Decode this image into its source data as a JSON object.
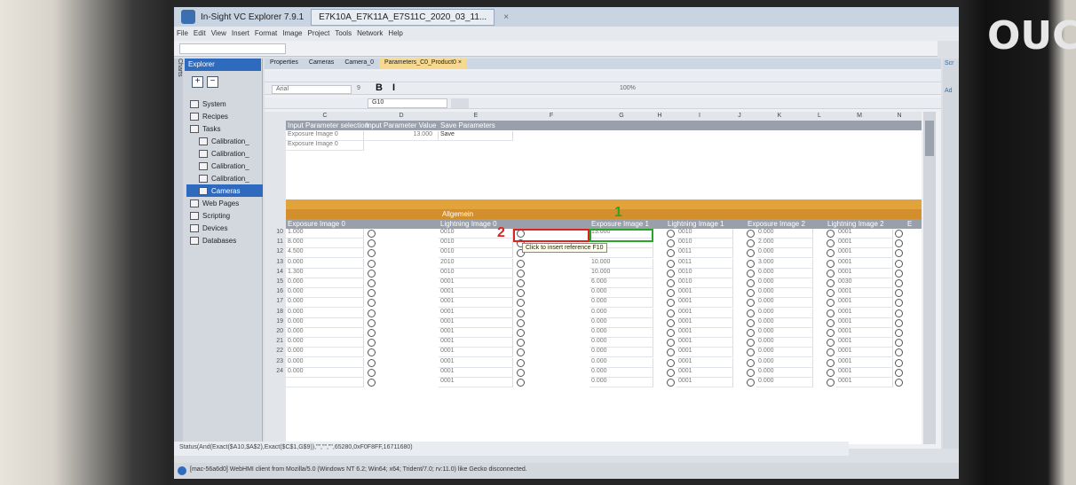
{
  "window": {
    "app_title": "In-Sight VC Explorer 7.9.1",
    "doc_tab": "E7K10A_E7K11A_E7S11C_2020_03_11...",
    "close_glyph": "×"
  },
  "brand_text": "OUCH",
  "menu": [
    "File",
    "Edit",
    "View",
    "Insert",
    "Format",
    "Image",
    "Project",
    "Tools",
    "Network",
    "Help"
  ],
  "sidebar": {
    "vertical_tab": "Charts",
    "header": "Explorer",
    "expand_glyph": "+",
    "collapse_glyph": "−",
    "items": [
      {
        "label": "System",
        "indent": 1
      },
      {
        "label": "Recipes",
        "indent": 1
      },
      {
        "label": "Tasks",
        "indent": 1
      },
      {
        "label": "Calibration_",
        "indent": 2
      },
      {
        "label": "Calibration_",
        "indent": 2
      },
      {
        "label": "Calibration_",
        "indent": 2
      },
      {
        "label": "Calibration_",
        "indent": 2
      },
      {
        "label": "Cameras",
        "indent": 2,
        "selected": true
      },
      {
        "label": "Web Pages",
        "indent": 1
      },
      {
        "label": "Scripting",
        "indent": 1
      },
      {
        "label": "Devices",
        "indent": 1
      },
      {
        "label": "Databases",
        "indent": 1
      }
    ]
  },
  "doc_tabs": [
    "Properties",
    "Cameras",
    "Camera_0",
    "Parameters_C0_Product0 ×"
  ],
  "toolbar": {
    "font": "Arial",
    "size": "9",
    "format_buttons": "B I",
    "cell_ref": "G10",
    "zoom": "100%"
  },
  "columns": [
    "C",
    "D",
    "E",
    "F",
    "G",
    "H",
    "I",
    "J",
    "K",
    "L",
    "M",
    "N"
  ],
  "top_headers": {
    "c": "Input Parameter selection",
    "d": "Input Parameter Value",
    "e": "Save Parameters"
  },
  "row1": {
    "c": "Exposure Image 0",
    "d": "13.000",
    "e": "Save"
  },
  "row2": {
    "c": "Exposure Image 0"
  },
  "section_label": "Allgemein",
  "lower_headers": {
    "c": "Exposure Image 0",
    "e": "Lightning Image 0",
    "g": "Exposure Image 1",
    "i": "Lightning Image 1",
    "k": "Exposure Image 2",
    "m": "Lightning Image 2",
    "n": "E"
  },
  "rows": [
    {
      "n": "10",
      "c": "1.000",
      "e": "0010",
      "g": "13.000",
      "i": "0010",
      "k": "0.000",
      "m": "0001"
    },
    {
      "n": "11",
      "c": "8.000",
      "e": "0010",
      "g": "",
      "i": "0010",
      "k": "2.000",
      "m": "0001"
    },
    {
      "n": "12",
      "c": "4.500",
      "e": "0010",
      "g": "",
      "i": "0011",
      "k": "0.000",
      "m": "0001"
    },
    {
      "n": "13",
      "c": "0.000",
      "e": "2010",
      "g": "10.000",
      "i": "0011",
      "k": "3.000",
      "m": "0001"
    },
    {
      "n": "14",
      "c": "1.300",
      "e": "0010",
      "g": "10.000",
      "i": "0010",
      "k": "0.000",
      "m": "0001"
    },
    {
      "n": "15",
      "c": "0.000",
      "e": "0001",
      "g": "6.000",
      "i": "0010",
      "k": "0.000",
      "m": "0030"
    },
    {
      "n": "16",
      "c": "0.000",
      "e": "0001",
      "g": "0.000",
      "i": "0001",
      "k": "0.000",
      "m": "0001"
    },
    {
      "n": "17",
      "c": "0.000",
      "e": "0001",
      "g": "0.000",
      "i": "0001",
      "k": "0.000",
      "m": "0001"
    },
    {
      "n": "18",
      "c": "0.000",
      "e": "0001",
      "g": "0.000",
      "i": "0001",
      "k": "0.000",
      "m": "0001"
    },
    {
      "n": "19",
      "c": "0.000",
      "e": "0001",
      "g": "0.000",
      "i": "0001",
      "k": "0.000",
      "m": "0001"
    },
    {
      "n": "20",
      "c": "0.000",
      "e": "0001",
      "g": "0.000",
      "i": "0001",
      "k": "0.000",
      "m": "0001"
    },
    {
      "n": "21",
      "c": "0.000",
      "e": "0001",
      "g": "0.000",
      "i": "0001",
      "k": "0.000",
      "m": "0001"
    },
    {
      "n": "22",
      "c": "0.000",
      "e": "0001",
      "g": "0.000",
      "i": "0001",
      "k": "0.000",
      "m": "0001"
    },
    {
      "n": "23",
      "c": "0.000",
      "e": "0001",
      "g": "0.000",
      "i": "0001",
      "k": "0.000",
      "m": "0001"
    },
    {
      "n": "24",
      "c": "0.000",
      "e": "0001",
      "g": "0.000",
      "i": "0001",
      "k": "0.000",
      "m": "0001"
    },
    {
      "n": "",
      "c": "",
      "e": "0001",
      "g": "0.000",
      "i": "0001",
      "k": "0.000",
      "m": "0001"
    }
  ],
  "annotations": {
    "red_label": "2",
    "green_label": "1",
    "tooltip": "Click to insert reference F10"
  },
  "status_formula": "Status(And(Exact($A10,$A$2),Exact($C$1,G$9)),\"\",\"\",\"\",65280,0xF0F8FF,16711680)",
  "bottom_message": "[mac-56a6d0] WebHMI client from Mozilla/5.0 (Windows NT 6.2; Win64; x64; Trident/7.0; rv:11.0) like Gecko disconnected.",
  "right_panel": {
    "label1": "Scr",
    "label2": "Ad"
  },
  "colors": {
    "accent": "#2e6bbf",
    "header_band": "#9aa0ab",
    "section_band": "#e3a33b",
    "annotation_red": "#dd2222",
    "annotation_green": "#2aa52a"
  }
}
